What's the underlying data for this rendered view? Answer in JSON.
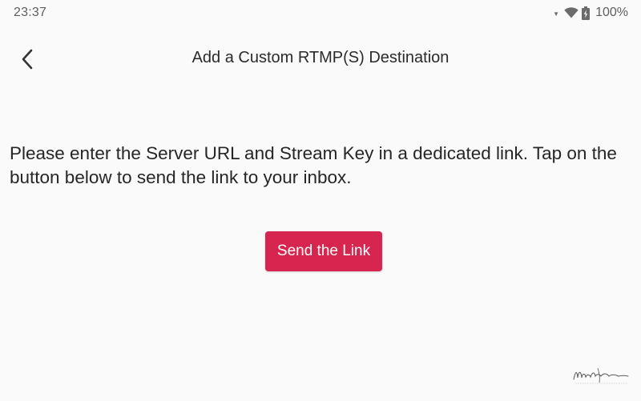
{
  "status_bar": {
    "time": "23:37",
    "battery_percent": "100%",
    "icons": [
      "signal-arrow-icon",
      "wifi-icon",
      "battery-charging-icon"
    ]
  },
  "app_bar": {
    "back_icon": "chevron-left-icon",
    "title": "Add a Custom RTMP(S) Destination"
  },
  "main": {
    "instructions": "Please enter the Server URL and Stream Key in a dedicated link. Tap on the button below to send the link to your inbox.",
    "send_button_label": "Send the Link"
  },
  "colors": {
    "background": "#fafafa",
    "primary_button": "#d6264f",
    "text_primary": "#262626",
    "status_text": "#5f5f5f"
  }
}
